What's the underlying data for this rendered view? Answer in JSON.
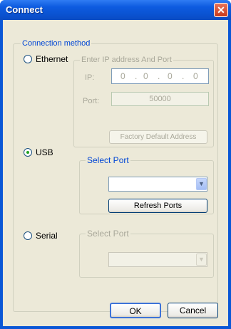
{
  "window": {
    "title": "Connect",
    "close_glyph": "✕"
  },
  "connection_method": {
    "legend": "Connection method"
  },
  "ethernet": {
    "radio_label": "Ethernet",
    "group_legend": "Enter IP address And Port",
    "ip_label": "IP:",
    "ip_octets": [
      "0",
      "0",
      "0",
      "0"
    ],
    "port_label": "Port:",
    "port_value": "50000",
    "factory_default_label": "Factory Default Address"
  },
  "usb": {
    "radio_label": "USB",
    "selected": true,
    "group_legend": "Select Port",
    "port_value": "",
    "refresh_label": "Refresh Ports"
  },
  "serial": {
    "radio_label": "Serial",
    "group_legend": "Select Port",
    "port_value": ""
  },
  "footer": {
    "ok_label": "OK",
    "cancel_label": "Cancel"
  },
  "colors": {
    "titlebar": "#0a57d6",
    "dialog_bg": "#ece9d8",
    "group_legend_blue": "#0046d5",
    "close_red": "#c8391b"
  },
  "icons": {
    "close": "close-icon",
    "dropdown": "chevron-down-icon"
  }
}
